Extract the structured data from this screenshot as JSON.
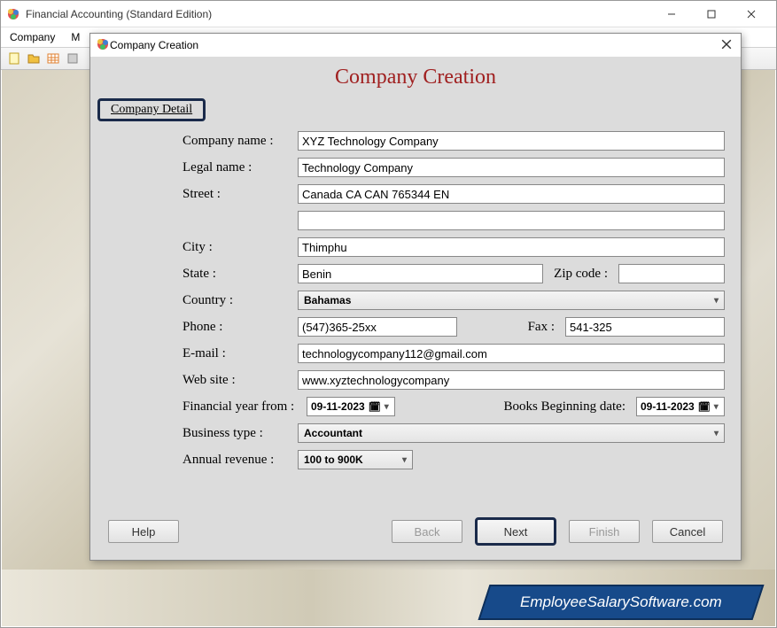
{
  "app": {
    "title": "Financial Accounting (Standard Edition)"
  },
  "menu": {
    "company": "Company",
    "m": "M"
  },
  "dialog": {
    "title": "Company Creation",
    "heading": "Company Creation",
    "section": "Company Detail",
    "labels": {
      "company_name": "Company name :",
      "legal_name": "Legal name :",
      "street": "Street :",
      "city": "City :",
      "state": "State :",
      "zip": "Zip code :",
      "country": "Country :",
      "phone": "Phone :",
      "fax": "Fax :",
      "email": "E-mail :",
      "website": "Web site :",
      "fy_from": "Financial year from :",
      "books_begin": "Books Beginning date:",
      "business_type": "Business type :",
      "annual_revenue": "Annual revenue :"
    },
    "values": {
      "company_name": "XYZ Technology Company",
      "legal_name": "Technology Company",
      "street1": "Canada CA CAN 765344 EN",
      "street2": "",
      "city": "Thimphu",
      "state": "Benin",
      "zip": "",
      "country": "Bahamas",
      "phone": "(547)365-25xx",
      "fax": "541-325",
      "email": "technologycompany112@gmail.com",
      "website": "www.xyztechnologycompany",
      "fy_from": "09-11-2023",
      "books_begin": "09-11-2023",
      "business_type": "Accountant",
      "annual_revenue": "100 to 900K"
    },
    "buttons": {
      "help": "Help",
      "back": "Back",
      "next": "Next",
      "finish": "Finish",
      "cancel": "Cancel"
    }
  },
  "footer": {
    "text": "EmployeeSalarySoftware.com"
  }
}
